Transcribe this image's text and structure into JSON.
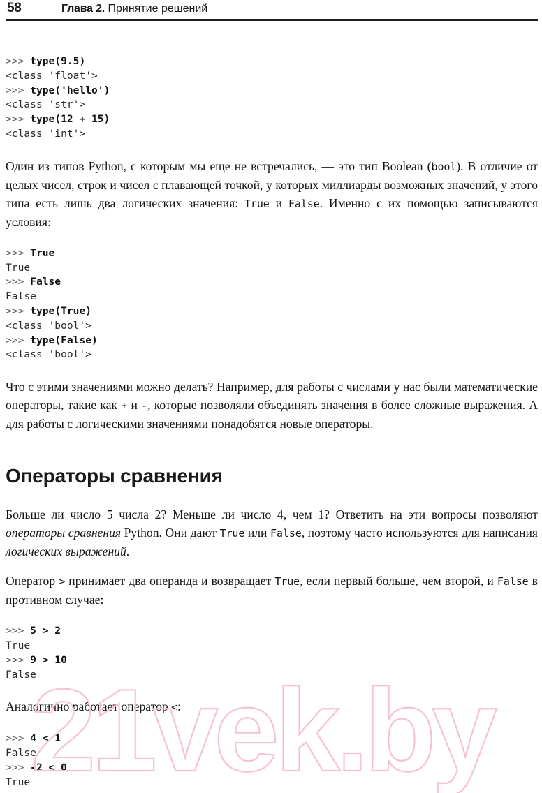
{
  "page": {
    "folio": "58",
    "running_head_chapter": "Глава 2.",
    "running_head_title": "Принятие решений"
  },
  "watermark": {
    "text": "21vek.by",
    "color": "#f6c2ce"
  },
  "code_blocks": [
    {
      "id": "type-examples",
      "lines": [
        {
          "kind": "input",
          "prompt": ">>> ",
          "text": "type(9.5)"
        },
        {
          "kind": "output",
          "prompt": "",
          "text": "<class 'float'>"
        },
        {
          "kind": "input",
          "prompt": ">>> ",
          "text": "type('hello')"
        },
        {
          "kind": "output",
          "prompt": "",
          "text": "<class 'str'>"
        },
        {
          "kind": "input",
          "prompt": ">>> ",
          "text": "type(12 + 15)"
        },
        {
          "kind": "output",
          "prompt": "",
          "text": "<class 'int'>"
        }
      ]
    },
    {
      "id": "bool-examples",
      "lines": [
        {
          "kind": "input",
          "prompt": ">>> ",
          "text": "True"
        },
        {
          "kind": "output",
          "prompt": "",
          "text": "True"
        },
        {
          "kind": "input",
          "prompt": ">>> ",
          "text": "False"
        },
        {
          "kind": "output",
          "prompt": "",
          "text": "False"
        },
        {
          "kind": "input",
          "prompt": ">>> ",
          "text": "type(True)"
        },
        {
          "kind": "output",
          "prompt": "",
          "text": "<class 'bool'>"
        },
        {
          "kind": "input",
          "prompt": ">>> ",
          "text": "type(False)"
        },
        {
          "kind": "output",
          "prompt": "",
          "text": "<class 'bool'>"
        }
      ]
    },
    {
      "id": "greater-than-examples",
      "lines": [
        {
          "kind": "input",
          "prompt": ">>> ",
          "text": "5 > 2"
        },
        {
          "kind": "output",
          "prompt": "",
          "text": "True"
        },
        {
          "kind": "input",
          "prompt": ">>> ",
          "text": "9 > 10"
        },
        {
          "kind": "output",
          "prompt": "",
          "text": "False"
        }
      ]
    },
    {
      "id": "less-than-examples",
      "lines": [
        {
          "kind": "input",
          "prompt": ">>> ",
          "text": "4 < 1"
        },
        {
          "kind": "output",
          "prompt": "",
          "text": "False"
        },
        {
          "kind": "input",
          "prompt": ">>> ",
          "text": "-2 < 0"
        },
        {
          "kind": "output",
          "prompt": "",
          "text": "True"
        }
      ]
    }
  ],
  "paragraphs": {
    "boolean_intro": {
      "runs": [
        {
          "style": "normal",
          "text": "Один из типов Python, с которым мы еще не встречались, — это тип Boolean ("
        },
        {
          "style": "mono",
          "text": "bool"
        },
        {
          "style": "normal",
          "text": "). В отличие от целых чисел, строк и чисел с плавающей точкой, у которых миллиарды возможных значений, у этого типа есть лишь два логических значения: "
        },
        {
          "style": "mono",
          "text": "True"
        },
        {
          "style": "normal",
          "text": " и "
        },
        {
          "style": "mono",
          "text": "False"
        },
        {
          "style": "normal",
          "text": ". Именно с их помощью записываются условия:"
        }
      ]
    },
    "what_to_do": {
      "runs": [
        {
          "style": "normal",
          "text": "Что с этими значениями можно делать? Например, для работы с числами у нас были математические операторы, такие как "
        },
        {
          "style": "mono",
          "text": "+"
        },
        {
          "style": "normal",
          "text": " и "
        },
        {
          "style": "mono",
          "text": "-"
        },
        {
          "style": "normal",
          "text": ", которые позволяли объединять значения в более сложные выражения. А для работы с логическими значениями понадобятся новые операторы."
        }
      ]
    },
    "comparison_intro": {
      "runs": [
        {
          "style": "normal",
          "text": "Больше ли число 5 числа 2? Меньше ли число 4, чем 1? Ответить на эти вопросы позволяют "
        },
        {
          "style": "italic",
          "text": "операторы сравнения"
        },
        {
          "style": "normal",
          "text": " Python. Они дают "
        },
        {
          "style": "mono",
          "text": "True"
        },
        {
          "style": "normal",
          "text": " или "
        },
        {
          "style": "mono",
          "text": "False"
        },
        {
          "style": "normal",
          "text": ", поэтому часто используются для написания "
        },
        {
          "style": "italic",
          "text": "логических выражений"
        },
        {
          "style": "normal",
          "text": "."
        }
      ]
    },
    "operator_gt": {
      "runs": [
        {
          "style": "normal",
          "text": "Оператор "
        },
        {
          "style": "mono",
          "text": ">"
        },
        {
          "style": "normal",
          "text": " принимает два операнда и возвращает "
        },
        {
          "style": "mono",
          "text": "True"
        },
        {
          "style": "normal",
          "text": ", если первый больше, чем второй, и "
        },
        {
          "style": "mono",
          "text": "False"
        },
        {
          "style": "normal",
          "text": " в противном случае:"
        }
      ]
    },
    "operator_lt": {
      "runs": [
        {
          "style": "normal",
          "text": "Аналогично работает оператор "
        },
        {
          "style": "mono",
          "text": "<"
        },
        {
          "style": "normal",
          "text": ":"
        }
      ]
    }
  },
  "headings": {
    "comparison_operators": "Операторы сравнения"
  }
}
